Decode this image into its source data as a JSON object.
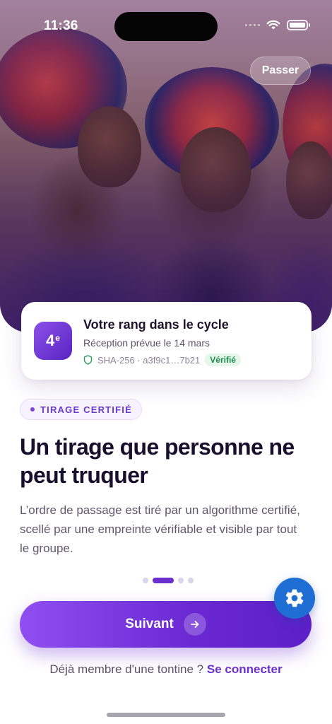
{
  "status_bar": {
    "time": "11:36"
  },
  "hero": {
    "skip_label": "Passer"
  },
  "rank_card": {
    "rank_number": "4",
    "rank_suffix": "e",
    "title": "Votre rang dans le cycle",
    "subtitle": "Réception prévue le 14 mars",
    "hash": "SHA-256 · a3f9c1…7b21",
    "verified_label": "Vérifié"
  },
  "tag": {
    "label": "TIRAGE CERTIFIÉ"
  },
  "headline": "Un tirage que personne ne peut truquer",
  "body": "L’ordre de passage est tiré par un algorithme certifié, scellé par une empreinte vérifiable et visible par tout le groupe.",
  "pager": {
    "total": 4,
    "active_index": 1
  },
  "cta": {
    "label": "Suivant"
  },
  "login": {
    "prompt": "Déjà membre d'une tontine ?",
    "link": "Se connecter"
  },
  "colors": {
    "accent": "#6b2fd0",
    "verified": "#1f8a4c",
    "fab": "#1f6ed4"
  }
}
